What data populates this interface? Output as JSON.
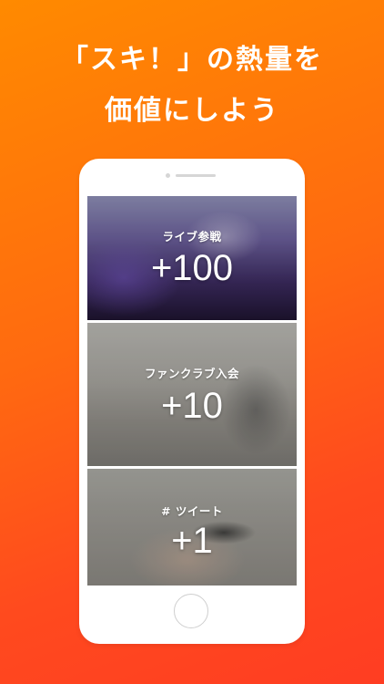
{
  "headline": {
    "line1": "「スキ！」の熱量を",
    "line2": "価値にしよう"
  },
  "cards": [
    {
      "label": "ライブ参戦",
      "points": "+100"
    },
    {
      "label": "ファンクラブ入会",
      "points": "+10"
    },
    {
      "label": "# ツイート",
      "points": "+1"
    }
  ],
  "colors": {
    "gradient_start": "#ff8a00",
    "gradient_end": "#ff3d22",
    "text": "#ffffff"
  }
}
